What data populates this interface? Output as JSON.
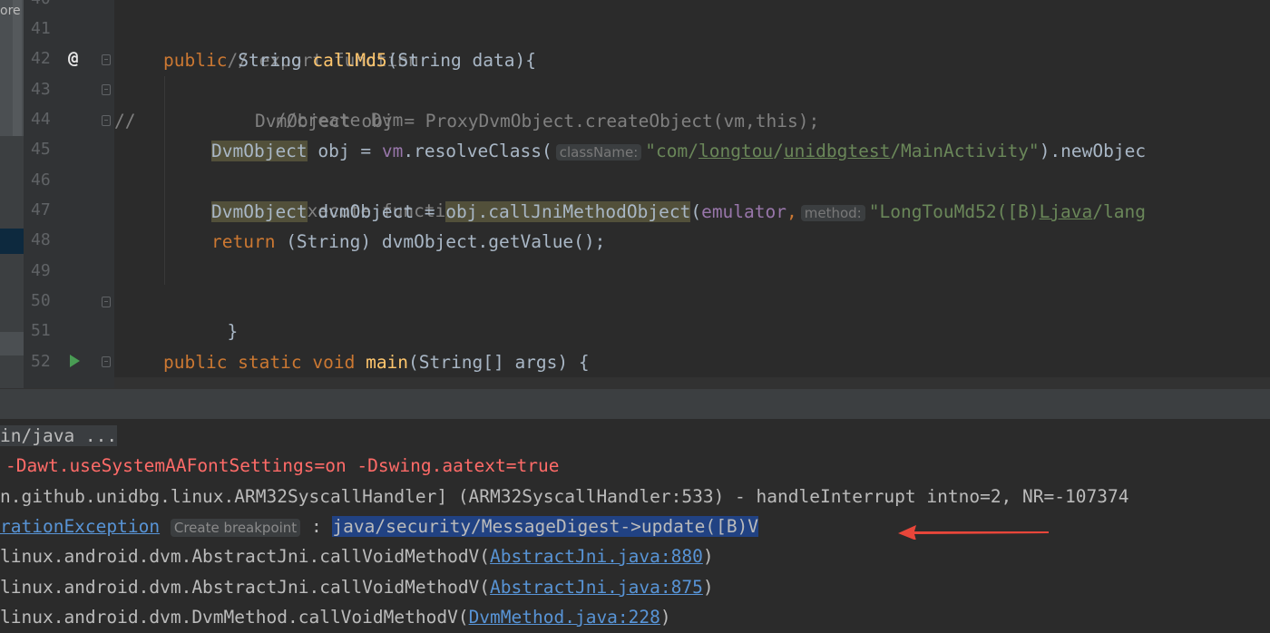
{
  "editor": {
    "strip_label": "ore",
    "line_numbers": [
      "40",
      "41",
      "42",
      "43",
      "44",
      "45",
      "46",
      "47",
      "48",
      "49",
      "50",
      "51",
      "52"
    ],
    "lines": {
      "l41": "// export function",
      "l42_kw": "public",
      "l42_type": "String",
      "l42_fn": "callMd5",
      "l42_rest": "(String data){",
      "l43": "//create Dvm",
      "l44_prefix": "//",
      "l44": "  DvmObject obj = ProxyDvmObject.createObject(vm,this);",
      "l45_type": "DvmObject",
      "l45_mid": " obj = ",
      "l45_vm": "vm",
      "l45_call": ".resolveClass(",
      "l45_hint": "className:",
      "l45_str_a": "\"com/",
      "l45_str_b": "longtou",
      "l45_str_c": "/",
      "l45_str_d": "unidbgtest",
      "l45_str_e": "/MainActivity\"",
      "l45_end": ").newObjec",
      "l46": "//execute function",
      "l47_type": "DvmObject",
      "l47_mid": " dvmObject = ",
      "l47_call": "obj.callJniMethodObject",
      "l47_paren": "(",
      "l47_arg": "emulator",
      "l47_comma": ",",
      "l47_hint": "method:",
      "l47_str_a": "\"LongTouMd52([B)",
      "l47_str_b": "Ljava",
      "l47_str_c": "/lang",
      "l48_kw": "return",
      "l48_rest": " (String) dvmObject.getValue();",
      "l50": "}",
      "l52_kw": "public static void",
      "l52_fn": "main",
      "l52_rest": "(String[] args) {",
      "partial": "   ..    ..(  .  ..    .   .T'  .ull'  ()"
    }
  },
  "console": {
    "line1": "in/java ...",
    "line2": "-Dawt.useSystemAAFontSettings=on -Dswing.aatext=true",
    "line3": "n.github.unidbg.linux.ARM32SyscallHandler] (ARM32SyscallHandler:533) - handleInterrupt intno=2, NR=-107374",
    "line4_link": "rationException",
    "line4_hint": "Create breakpoint",
    "line4_sep": " : ",
    "line4_selected": "java/security/MessageDigest->update([B)V",
    "line5_prefix": "linux.android.dvm.AbstractJni.callVoidMethodV(",
    "line5_link": "AbstractJni.java:880",
    "line5_suffix": ")",
    "line6_prefix": "linux.android.dvm.AbstractJni.callVoidMethodV(",
    "line6_link": "AbstractJni.java:875",
    "line6_suffix": ")",
    "line7_prefix": "linux.android.dvm.DvmMethod.callVoidMethodV(",
    "line7_link": "DvmMethod.java:228",
    "line7_suffix": ")"
  },
  "annotation": {
    "arrow_color": "#e8463a"
  }
}
